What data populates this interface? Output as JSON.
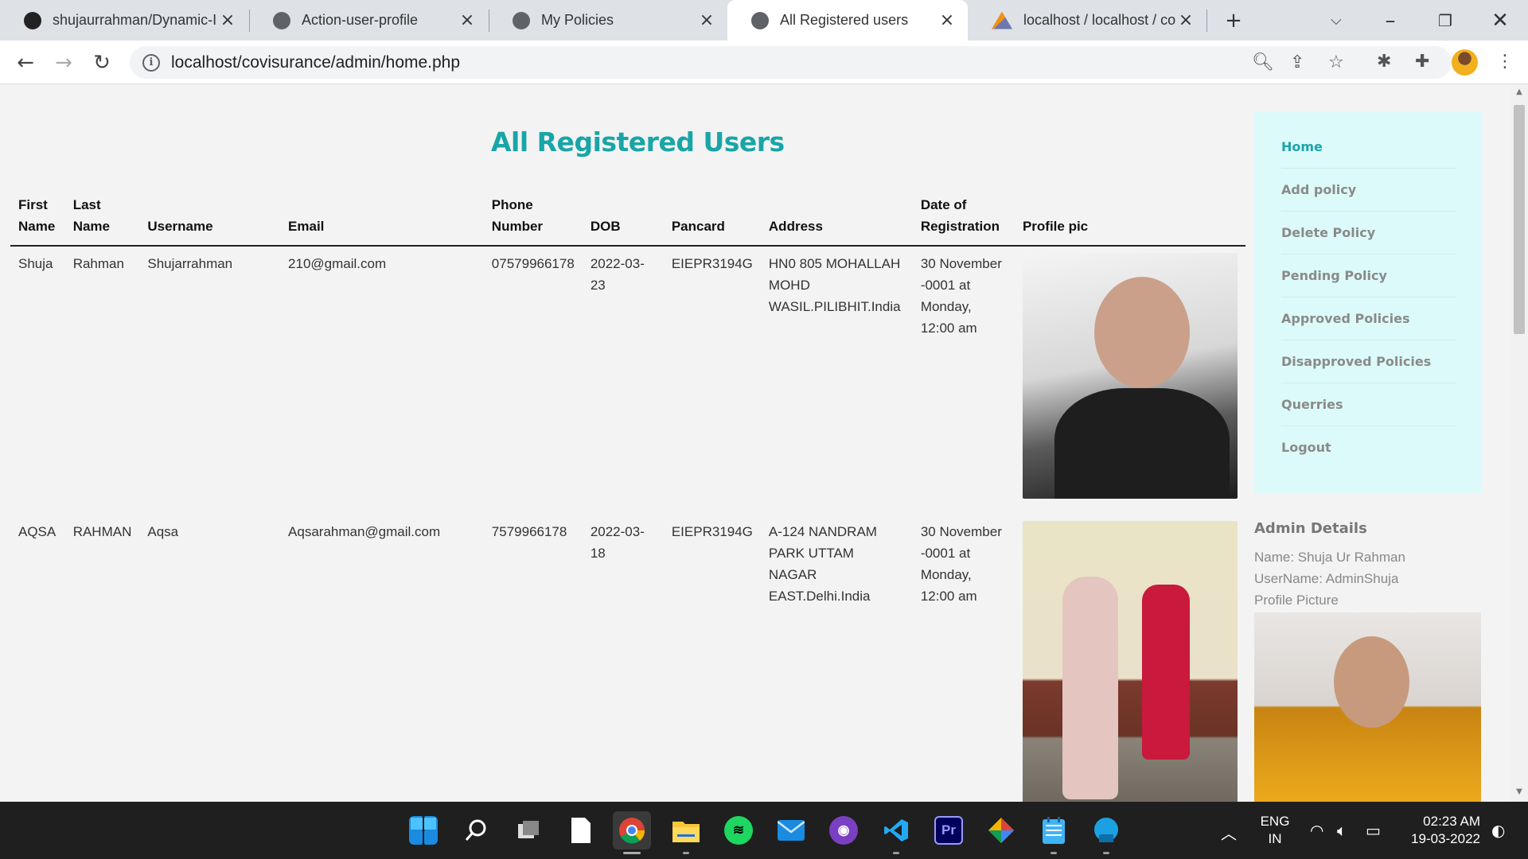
{
  "browser": {
    "tabs": [
      {
        "title": "shujaurrahman/Dynamic-I",
        "favicon": "github-icon"
      },
      {
        "title": "Action-user-profile",
        "favicon": "globe-icon"
      },
      {
        "title": "My Policies",
        "favicon": "globe-icon"
      },
      {
        "title": "All Registered users",
        "favicon": "globe-icon",
        "active": true
      },
      {
        "title": "localhost / localhost / co",
        "favicon": "phpmyadmin-icon"
      }
    ],
    "url": "localhost/covisurance/admin/home.php"
  },
  "page": {
    "title": "All Registered Users",
    "accent_color": "#19a5a8",
    "table": {
      "headers": {
        "first_name": "First Name",
        "last_name": "Last Name",
        "username": "Username",
        "email": "Email",
        "phone": "Phone Number",
        "dob": "DOB",
        "pancard": "Pancard",
        "address": "Address",
        "date_registration": "Date of Registration",
        "profile_pic": "Profile pic"
      },
      "rows": [
        {
          "first_name": "Shuja",
          "last_name": "Rahman",
          "username": "Shujarrahman",
          "email": "210@gmail.com",
          "phone": "07579966178",
          "dob": "2022-03-23",
          "pancard": "EIEPR3194G",
          "address": "HN0 805 MOHALLAH MOHD WASIL.PILIBHIT.India",
          "date_registration": "30 November -0001 at Monday, 12:00 am"
        },
        {
          "first_name": "AQSA",
          "last_name": "RAHMAN",
          "username": "Aqsa",
          "email": "Aqsarahman@gmail.com",
          "phone": "7579966178",
          "dob": "2022-03-18",
          "pancard": "EIEPR3194G",
          "address": "A-124 NANDRAM PARK UTTAM NAGAR EAST.Delhi.India",
          "date_registration": "30 November -0001 at Monday, 12:00 am"
        }
      ]
    },
    "sidebar": {
      "items": [
        "Home",
        "Add policy",
        "Delete Policy",
        "Pending Policy",
        "Approved Policies",
        "Disapproved Policies",
        "Querries",
        "Logout"
      ]
    },
    "admin": {
      "heading": "Admin Details",
      "name": "Name: Shuja Ur Rahman",
      "username": "UserName: AdminShuja",
      "picture_label": "Profile Picture"
    }
  },
  "taskbar": {
    "language": "ENG",
    "region": "IN",
    "time": "02:23 AM",
    "date": "19-03-2022"
  }
}
